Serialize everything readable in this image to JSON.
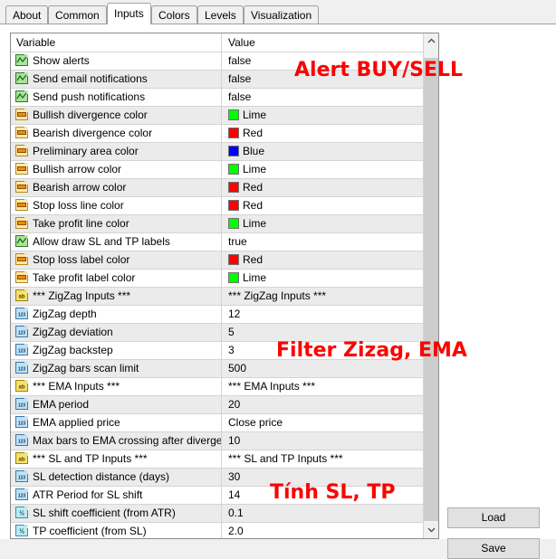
{
  "window": {
    "tabs": [
      {
        "label": "About",
        "selected": false
      },
      {
        "label": "Common",
        "selected": false
      },
      {
        "label": "Inputs",
        "selected": true
      },
      {
        "label": "Colors",
        "selected": false
      },
      {
        "label": "Levels",
        "selected": false
      },
      {
        "label": "Visualization",
        "selected": false
      }
    ]
  },
  "grid": {
    "columns": [
      "Variable",
      "Value"
    ],
    "rows": [
      {
        "icon": "bool-icon",
        "variable": "Show alerts",
        "value": "false",
        "value_kind": "text"
      },
      {
        "icon": "bool-icon",
        "variable": "Send email notifications",
        "value": "false",
        "value_kind": "text"
      },
      {
        "icon": "bool-icon",
        "variable": "Send push notifications",
        "value": "false",
        "value_kind": "text"
      },
      {
        "icon": "color-icon",
        "variable": "Bullish divergence color",
        "value": "Lime",
        "value_kind": "color",
        "swatch": "#00ff00"
      },
      {
        "icon": "color-icon",
        "variable": "Bearish divergence color",
        "value": "Red",
        "value_kind": "color",
        "swatch": "#ff0000"
      },
      {
        "icon": "color-icon",
        "variable": "Preliminary area color",
        "value": "Blue",
        "value_kind": "color",
        "swatch": "#0000ff"
      },
      {
        "icon": "color-icon",
        "variable": "Bullish arrow color",
        "value": "Lime",
        "value_kind": "color",
        "swatch": "#00ff00"
      },
      {
        "icon": "color-icon",
        "variable": "Bearish arrow color",
        "value": "Red",
        "value_kind": "color",
        "swatch": "#ff0000"
      },
      {
        "icon": "color-icon",
        "variable": "Stop loss line color",
        "value": "Red",
        "value_kind": "color",
        "swatch": "#ff0000"
      },
      {
        "icon": "color-icon",
        "variable": "Take profit line color",
        "value": "Lime",
        "value_kind": "color",
        "swatch": "#00ff00"
      },
      {
        "icon": "bool-icon",
        "variable": "Allow draw SL and TP labels",
        "value": "true",
        "value_kind": "text"
      },
      {
        "icon": "color-icon",
        "variable": "Stop loss label color",
        "value": "Red",
        "value_kind": "color",
        "swatch": "#ff0000"
      },
      {
        "icon": "color-icon",
        "variable": "Take profit label color",
        "value": "Lime",
        "value_kind": "color",
        "swatch": "#00ff00"
      },
      {
        "icon": "string-icon",
        "variable": "*** ZigZag Inputs ***",
        "value": "*** ZigZag Inputs ***",
        "value_kind": "text"
      },
      {
        "icon": "int-icon",
        "variable": "ZigZag depth",
        "value": "12",
        "value_kind": "text"
      },
      {
        "icon": "int-icon",
        "variable": "ZigZag deviation",
        "value": "5",
        "value_kind": "text"
      },
      {
        "icon": "int-icon",
        "variable": "ZigZag backstep",
        "value": "3",
        "value_kind": "text"
      },
      {
        "icon": "int-icon",
        "variable": "ZigZag bars scan limit",
        "value": "500",
        "value_kind": "text"
      },
      {
        "icon": "string-icon",
        "variable": "*** EMA Inputs ***",
        "value": "*** EMA Inputs ***",
        "value_kind": "text"
      },
      {
        "icon": "int-icon",
        "variable": "EMA period",
        "value": "20",
        "value_kind": "text"
      },
      {
        "icon": "int-icon",
        "variable": "EMA applied price",
        "value": "Close price",
        "value_kind": "text"
      },
      {
        "icon": "int-icon",
        "variable": "Max bars to EMA crossing after diverge...",
        "value": "10",
        "value_kind": "text"
      },
      {
        "icon": "string-icon",
        "variable": "*** SL and TP Inputs ***",
        "value": "*** SL and TP Inputs ***",
        "value_kind": "text"
      },
      {
        "icon": "int-icon",
        "variable": "SL detection distance (days)",
        "value": "30",
        "value_kind": "text"
      },
      {
        "icon": "int-icon",
        "variable": "ATR Period for SL shift",
        "value": "14",
        "value_kind": "text"
      },
      {
        "icon": "float-icon",
        "variable": "SL shift coefficient (from ATR)",
        "value": "0.1",
        "value_kind": "text"
      },
      {
        "icon": "float-icon",
        "variable": "TP coefficient (from SL)",
        "value": "2.0",
        "value_kind": "text"
      }
    ]
  },
  "scrollbar": {
    "up_icon": "chevron-up-icon",
    "down_icon": "chevron-down-icon"
  },
  "buttons": {
    "load_label": "Load",
    "save_label": "Save"
  },
  "annotations": [
    {
      "text": "Alert BUY/SELL",
      "color": "#fe0000"
    },
    {
      "text": "Filter Zizag, EMA",
      "color": "#fe0000"
    },
    {
      "text": "Tính SL, TP",
      "color": "#fe0000"
    }
  ]
}
